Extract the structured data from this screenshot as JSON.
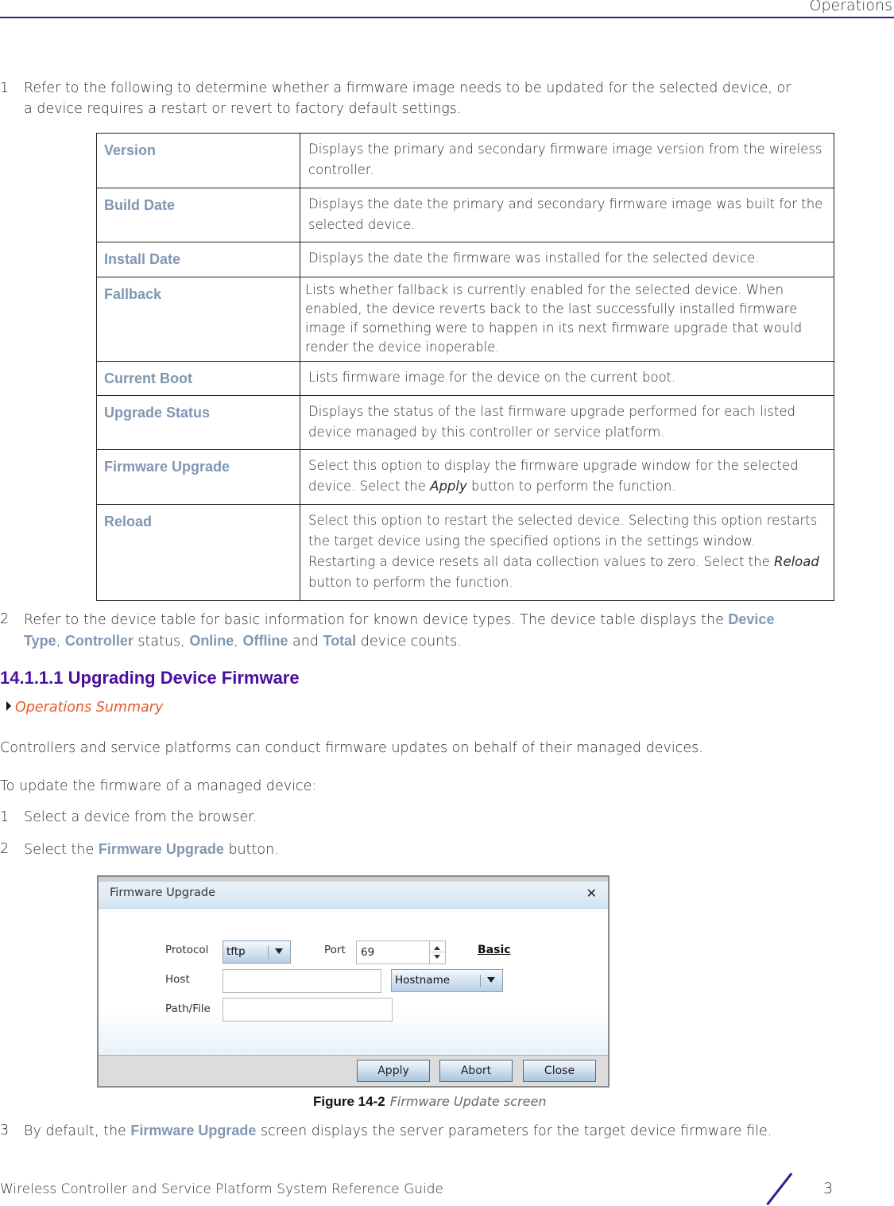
{
  "header": {
    "section_title": "Operations"
  },
  "step1": {
    "number": "1",
    "text_line1": "Refer to the following to determine whether a firmware image needs to be updated for the selected device, or",
    "text_line2": "a device requires a restart or revert to factory default settings."
  },
  "definitions": [
    {
      "term": "Version",
      "desc": "Displays the primary and secondary firmware image version from the wireless controller."
    },
    {
      "term": "Build Date",
      "desc": "Displays the date the primary and secondary firmware image was built for the selected device."
    },
    {
      "term": "Install Date",
      "desc": "Displays the date the firmware was installed for the selected device."
    },
    {
      "term": "Fallback",
      "desc": "Lists whether fallback is currently enabled for the selected device. When enabled, the device reverts back to the last successfully installed firmware image if something were to happen in its next firmware upgrade that would render the device inoperable."
    },
    {
      "term": "Current Boot",
      "desc": "Lists firmware image for the device on the current boot."
    },
    {
      "term": "Upgrade Status",
      "desc": "Displays the status of the last firmware upgrade performed for each listed device managed by this controller or service platform."
    },
    {
      "term": "Firmware Upgrade",
      "desc_before": "Select this option to display the firmware upgrade window for the selected device. Select the ",
      "desc_em": "Apply",
      "desc_after": " button to perform the function."
    },
    {
      "term": "Reload",
      "desc_before": "Select this option to restart the selected device. Selecting this option restarts the target device using the specified options in the settings window. Restarting a device resets all data collection values to zero. Select the ",
      "desc_em": "Reload",
      "desc_after": " button to perform the function."
    }
  ],
  "step2": {
    "number": "2",
    "text_a": "Refer to the device table for basic information for known device types. The device table displays the ",
    "kw_device": "Device",
    "kw_type": "Type",
    "sep1": ", ",
    "kw_controller": "Controller",
    "text_b": " status, ",
    "kw_online": "Online",
    "sep2": ", ",
    "kw_offline": "Offline",
    "text_c": " and ",
    "kw_total": "Total",
    "text_d": " device counts."
  },
  "section": {
    "heading": "14.1.1.1 Upgrading Device Firmware",
    "link": "Operations Summary",
    "intro": "Controllers and service platforms can conduct firmware updates on behalf of their managed devices.",
    "lead": "To update the firmware of a managed device:",
    "steps": [
      {
        "number": "1",
        "text": "Select a device from the browser."
      },
      {
        "number": "2",
        "text_before": "Select the ",
        "kw": "Firmware Upgrade",
        "text_after": " button."
      },
      {
        "number": "3",
        "text_before": "By default, the ",
        "kw": "Firmware Upgrade",
        "text_after": " screen displays the server parameters for the target device firmware file."
      }
    ]
  },
  "figure": {
    "dialog_title": "Firmware Upgrade",
    "close_icon": "close-x",
    "protocol_label": "Protocol",
    "protocol_value": "tftp",
    "port_label": "Port",
    "port_value": "69",
    "basic_link": "Basic",
    "host_label": "Host",
    "host_value": "",
    "host_type_value": "Hostname",
    "path_label": "Path/File",
    "path_value": "",
    "buttons": {
      "apply": "Apply",
      "abort": "Abort",
      "close": "Close"
    },
    "caption_number": "Figure 14-2",
    "caption_text": "Firmware Update screen"
  },
  "footer": {
    "guide_title": "Wireless Controller and Service Platform System Reference Guide",
    "page_number": "3"
  },
  "colors": {
    "keyword": "#7f97b3",
    "heading": "#4a0fa0",
    "link": "#e8582a",
    "rule": "#3a1b8a"
  }
}
